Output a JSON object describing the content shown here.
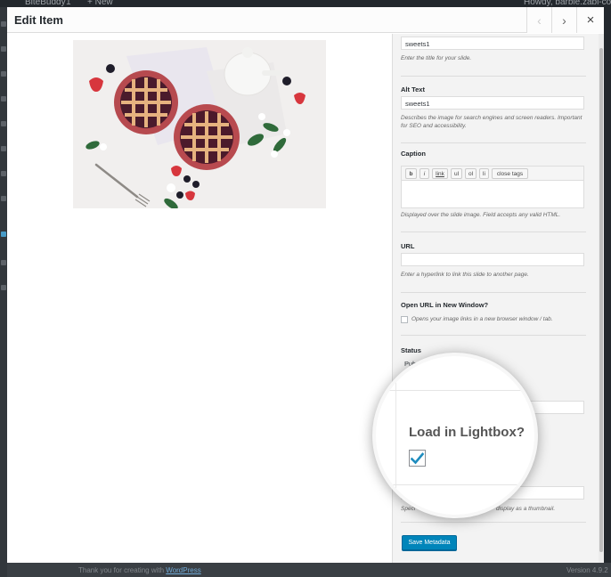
{
  "wp": {
    "adminbar": {
      "site_name": "BiteBuddy",
      "comment_count": "1",
      "new_label": "+ New",
      "greeting": "Howdy, barbie.zabl-com"
    },
    "footer": {
      "thanks_prefix": "Thank you for creating with",
      "thanks_link": "WordPress",
      "version": "Version 4.9.2"
    }
  },
  "modal": {
    "title": "Edit Item",
    "prev_icon": "chevron-left-icon",
    "next_icon": "chevron-right-icon",
    "close_icon": "close-icon",
    "prev_glyph": "‹",
    "next_glyph": "›",
    "close_glyph": "×"
  },
  "fields": {
    "title_value": "sweets1",
    "title_help": "Enter the title for your slide.",
    "alt_label": "Alt Text",
    "alt_value": "sweets1",
    "alt_help": "Describes the image for search engines and screen readers. Important for SEO and accessibility.",
    "caption_label": "Caption",
    "caption_toolbar": [
      "b",
      "i",
      "link",
      "ul",
      "ol",
      "li",
      "close tags"
    ],
    "caption_help": "Displayed over the slide image. Field accepts any valid HTML.",
    "url_label": "URL",
    "url_value": "",
    "url_help": "Enter a hyperlink to link this slide to another page.",
    "newwin_label": "Open URL in New Window?",
    "newwin_help": "Opens your image links in a new browser window / tab.",
    "status_label": "Status",
    "status_value": "Pub",
    "thumb_help_left": "Speci",
    "thumb_help_right": "display as a thumbnail.",
    "save_button": "Save Metadata"
  },
  "magnifier": {
    "label": "Load in Lightbox?",
    "checked": true
  },
  "colors": {
    "accent": "#0085ba",
    "check": "#1e8cbe"
  }
}
